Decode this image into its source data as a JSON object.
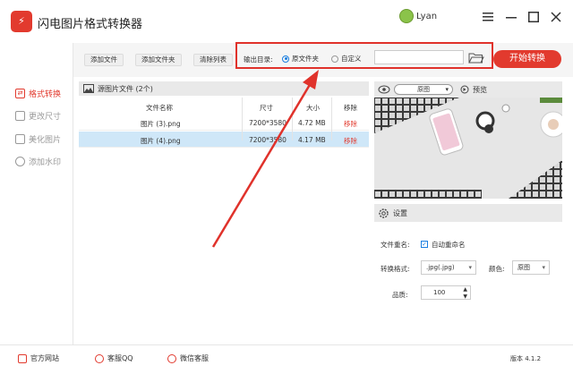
{
  "app": {
    "title": "闪电图片格式转换器",
    "logo_text": "⚡",
    "user_name": "Lyan"
  },
  "window_controls": [
    "menu-icon",
    "minimize-icon",
    "maximize-icon",
    "close-icon"
  ],
  "sidebar": {
    "items": [
      {
        "label": "格式转换",
        "icon": "convert-icon",
        "active": true
      },
      {
        "label": "更改尺寸",
        "icon": "resize-icon",
        "active": false
      },
      {
        "label": "美化图片",
        "icon": "beautify-icon",
        "active": false
      },
      {
        "label": "添加水印",
        "icon": "watermark-icon",
        "active": false
      }
    ]
  },
  "toolbar": {
    "add_file": "添加文件",
    "add_folder": "添加文件夹",
    "clear_list": "清除列表",
    "output_label": "输出目录:",
    "radio_source": "原文件夹",
    "radio_custom": "自定义",
    "path_value": "",
    "start_button": "开始转换"
  },
  "file_panel": {
    "title": "源图片文件 (2个)",
    "columns": [
      "文件名称",
      "尺寸",
      "大小",
      "移除"
    ],
    "rows": [
      {
        "name": "图片 (3).png",
        "size": "7200*3580",
        "filesize": "4.72 MB",
        "remove": "移除",
        "selected": false
      },
      {
        "name": "图片 (4).png",
        "size": "7200*3580",
        "filesize": "4.17 MB",
        "remove": "移除",
        "selected": true
      }
    ]
  },
  "preview": {
    "select_value": "原图",
    "label": "预览"
  },
  "settings": {
    "title": "设置",
    "rename_label": "文件重名:",
    "rename_checkbox": "自动重命名",
    "format_label": "转换格式:",
    "format_value": ".jpg(.jpg)",
    "color_label": "颜色:",
    "color_value": "原图",
    "quality_label": "品质:",
    "quality_value": "100"
  },
  "footer": {
    "website": "官方网站",
    "qq": "客服QQ",
    "wechat": "微信客服",
    "version": "版本 4.1.2"
  },
  "colors": {
    "accent": "#e23a2e",
    "highlight": "#e0322b",
    "selected_row": "#cfe7f8",
    "radio_on": "#1a7ee0"
  }
}
